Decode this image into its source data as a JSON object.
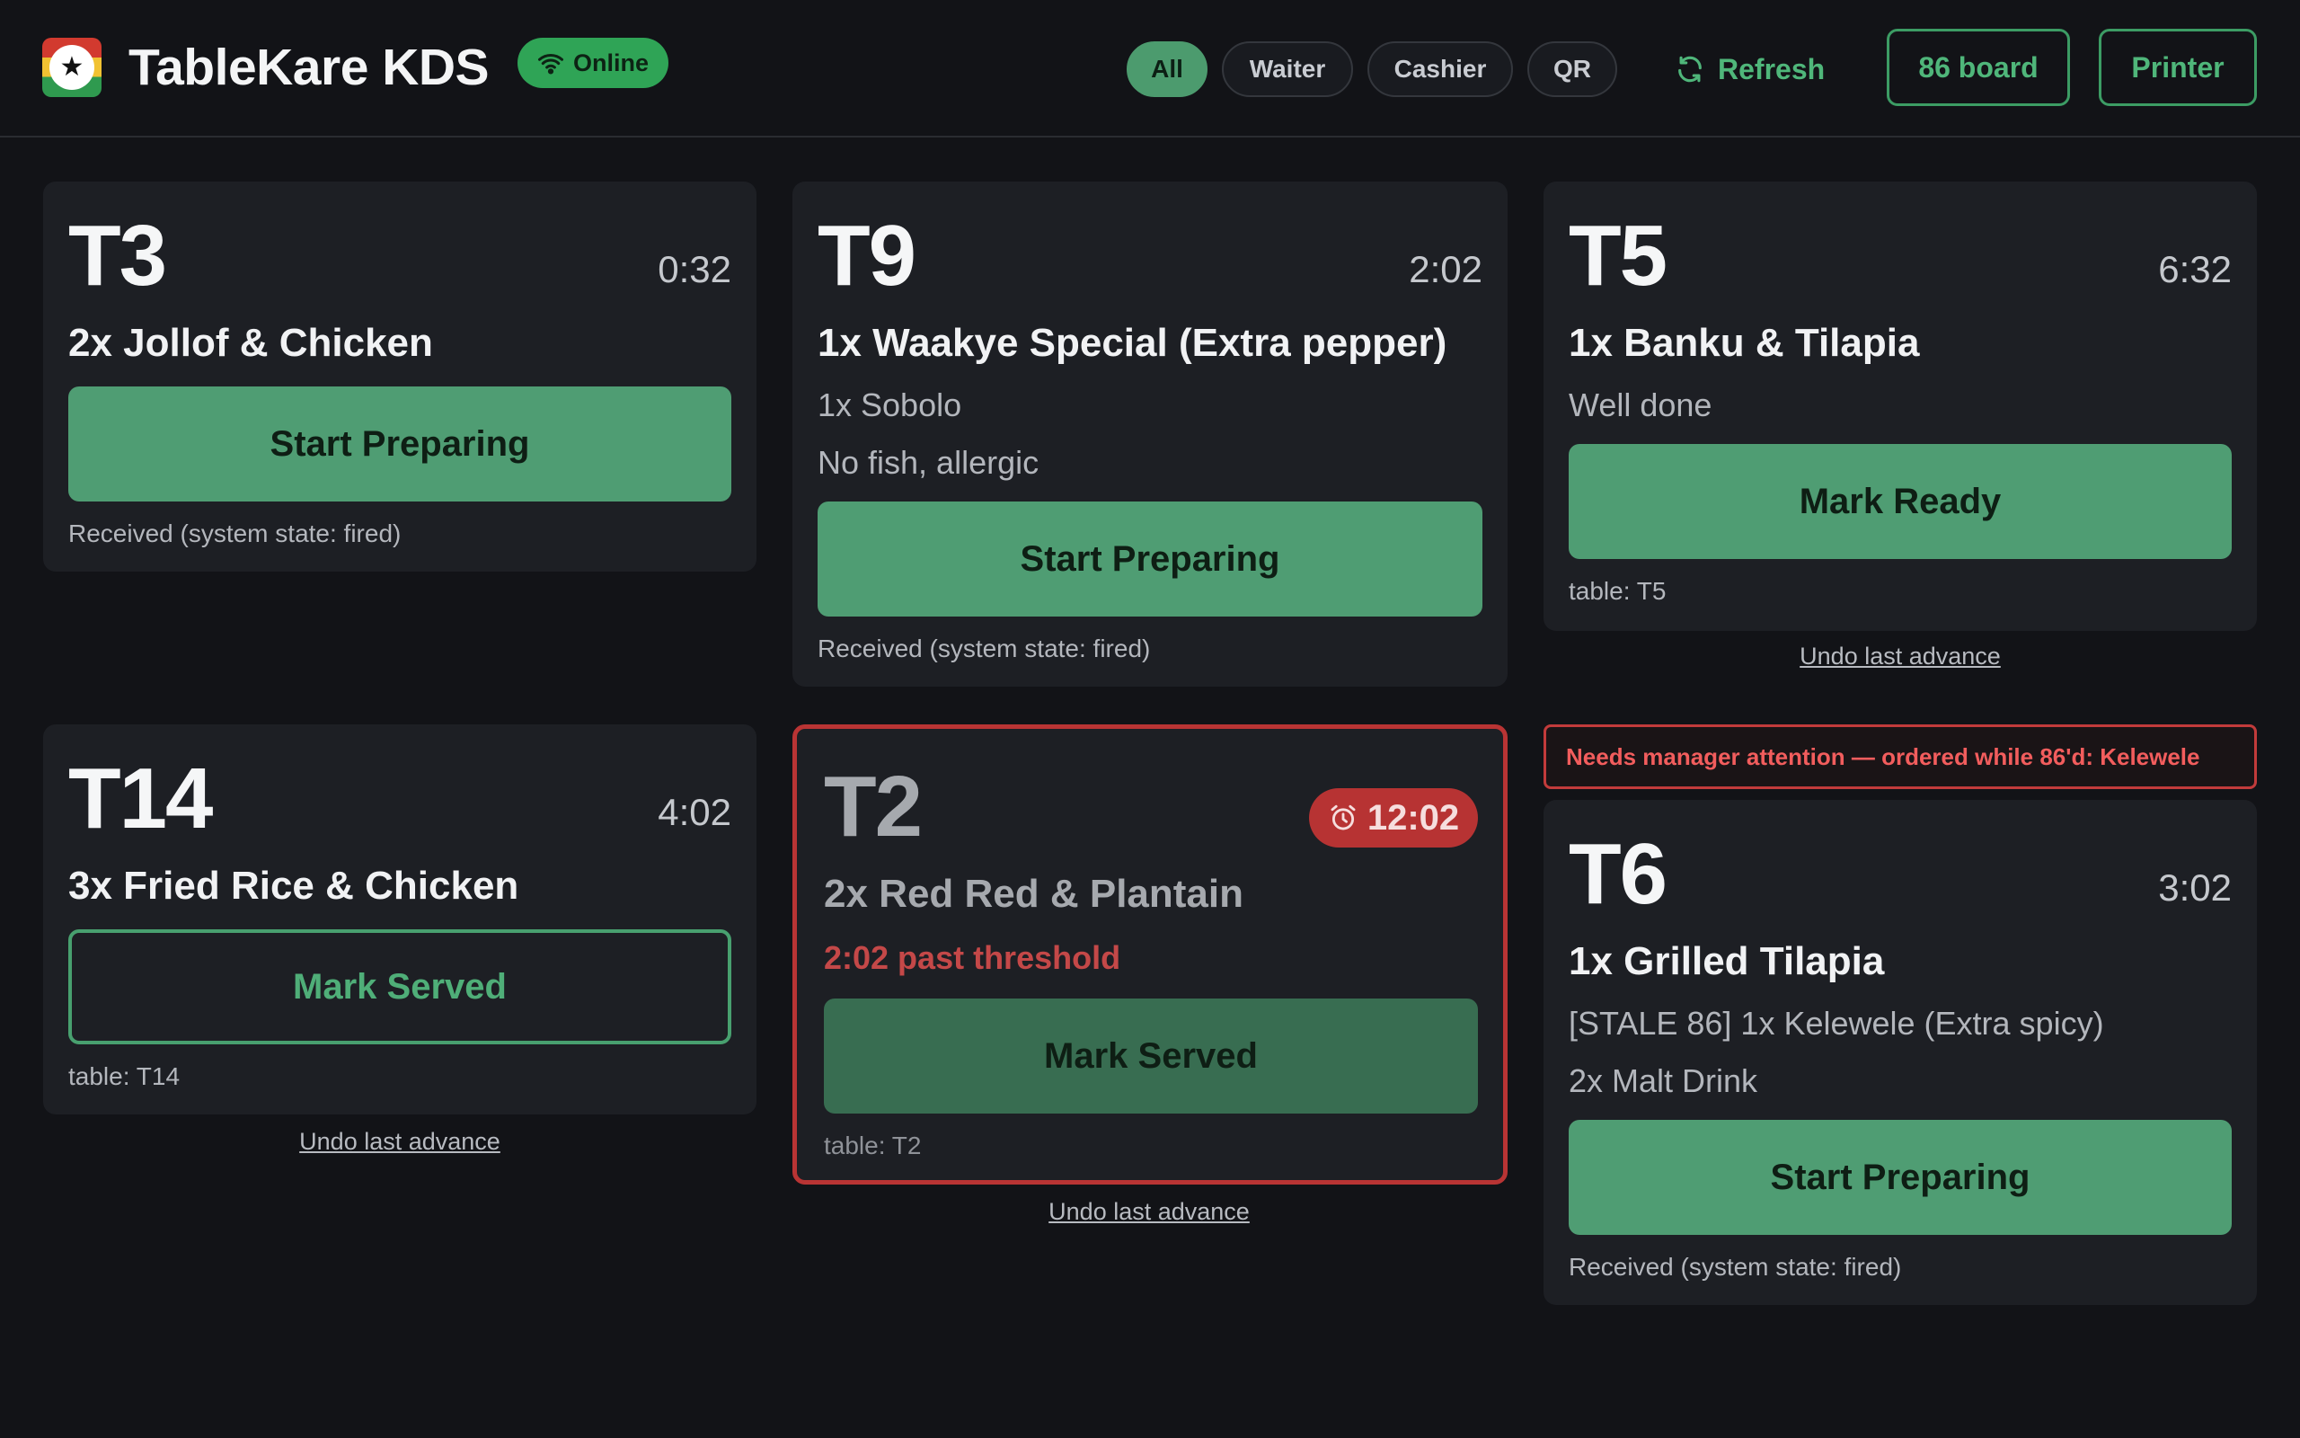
{
  "app": {
    "title": "TableKare KDS",
    "status": "Online",
    "accent_color": "#4f9d73",
    "alert_color": "#b93434"
  },
  "filters": {
    "all": "All",
    "waiter": "Waiter",
    "cashier": "Cashier",
    "qr": "QR",
    "selected": "All"
  },
  "toolbar": {
    "refresh": "Refresh",
    "board_86": "86 board",
    "printer": "Printer"
  },
  "tickets": {
    "t3": {
      "table": "T3",
      "timer": "0:32",
      "item": "2x Jollof & Chicken",
      "action": "Start Preparing",
      "meta": "Received (system state: fired)"
    },
    "t9": {
      "table": "T9",
      "timer": "2:02",
      "item": "1x Waakye Special (Extra pepper)",
      "line_1": "1x Sobolo",
      "line_2": "No fish, allergic",
      "action": "Start Preparing",
      "meta": "Received (system state: fired)"
    },
    "t5": {
      "table": "T5",
      "timer": "6:32",
      "item": "1x Banku & Tilapia",
      "line_1": "Well done",
      "action": "Mark Ready",
      "meta": "table: T5",
      "undo": "Undo last advance"
    },
    "t14": {
      "table": "T14",
      "timer": "4:02",
      "item": "3x Fried Rice & Chicken",
      "action": "Mark Served",
      "meta": "table: T14",
      "undo": "Undo last advance"
    },
    "t2": {
      "table": "T2",
      "timer": "12:02",
      "item": "2x Red Red & Plantain",
      "threshold": "2:02 past threshold",
      "action": "Mark Served",
      "meta": "table: T2",
      "undo": "Undo last advance"
    },
    "t6": {
      "alert": "Needs manager attention — ordered while 86'd: Kelewele",
      "table": "T6",
      "timer": "3:02",
      "item": "1x Grilled Tilapia",
      "line_1": "[STALE 86] 1x Kelewele (Extra spicy)",
      "line_2": "2x Malt Drink",
      "action": "Start Preparing",
      "meta": "Received (system state: fired)"
    }
  }
}
